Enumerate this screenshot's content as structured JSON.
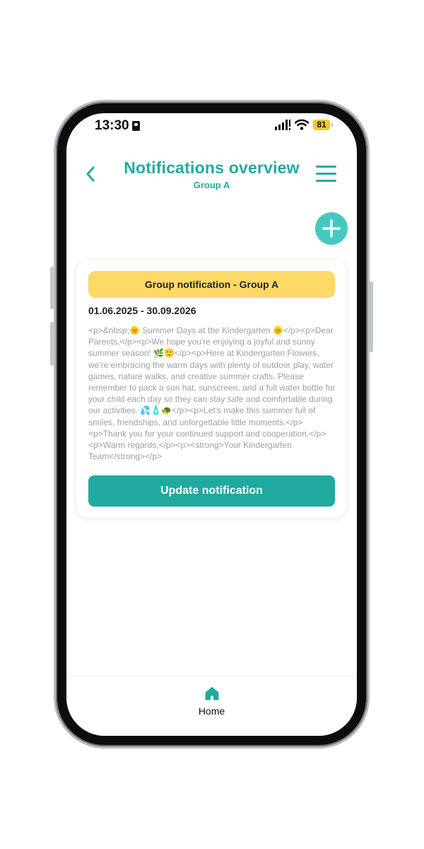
{
  "status_bar": {
    "time": "13:30",
    "battery": "81"
  },
  "header": {
    "title": "Notifications overview",
    "subtitle": "Group A",
    "back_icon": "chevron-left-icon",
    "menu_icon": "hamburger-menu-icon"
  },
  "fab": {
    "icon": "plus-icon"
  },
  "card": {
    "badge": "Group notification - Group A",
    "date_range": "01.06.2025 - 30.09.2026",
    "body": "<p>&nbsp;🌞 Summer Days at the Kindergarten 🌞</p><p>Dear Parents,</p><p>We hope you're enjoying a joyful and sunny summer season! 🌿🙂</p><p>Here at Kindergarten Flowers, we're embracing the warm days with plenty of outdoor play, water games, nature walks, and creative summer crafts. Please remember to pack a sun hat, sunscreen, and a full water bottle for your child each day so they can stay safe and comfortable during our activities. 💦🧴🐢</p><p>Let's make this summer full of smiles, friendships, and unforgettable little moments.</p><p>Thank you for your continued support and cooperation.</p><p>Warm regards,</p><p><strong>Your Kindergarten Team</strong></p>",
    "update_button": "Update notification"
  },
  "bottom_nav": {
    "home_label": "Home",
    "home_icon": "home-icon"
  },
  "colors": {
    "accent": "#22aaa0",
    "badge": "#ffd966",
    "fab": "#45c9bf"
  }
}
